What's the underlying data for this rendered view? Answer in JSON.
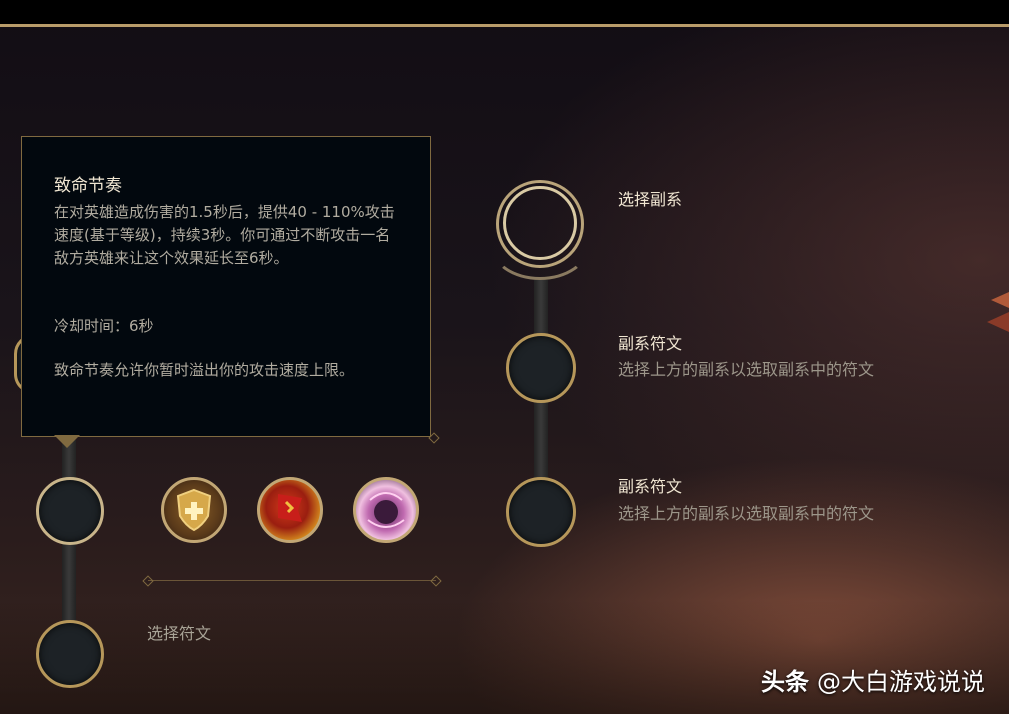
{
  "tooltip": {
    "title": "致命节奏",
    "description": "在对英雄造成伤害的1.5秒后，提供40 - 110%攻击速度(基于等级)，持续3秒。你可通过不断攻击一名敌方英雄来让这个效果延长至6秒。",
    "cooldown": "冷却时间：6秒",
    "note": "致命节奏允许你暂时溢出你的攻击速度上限。"
  },
  "left_panel": {
    "select_rune_label": "选择符文",
    "runes": [
      {
        "icon": "shield-cross-rune-icon"
      },
      {
        "icon": "red-banner-rune-icon"
      },
      {
        "icon": "pink-orb-rune-icon"
      }
    ]
  },
  "right_panel": {
    "secondary_title": "选择副系",
    "rows": [
      {
        "title": "副系符文",
        "subtitle": "选择上方的副系以选取副系中的符文"
      },
      {
        "title": "副系符文",
        "subtitle": "选择上方的副系以选取副系中的符文"
      }
    ]
  },
  "watermark": {
    "brand": "头条",
    "handle": "@大白游戏说说"
  }
}
